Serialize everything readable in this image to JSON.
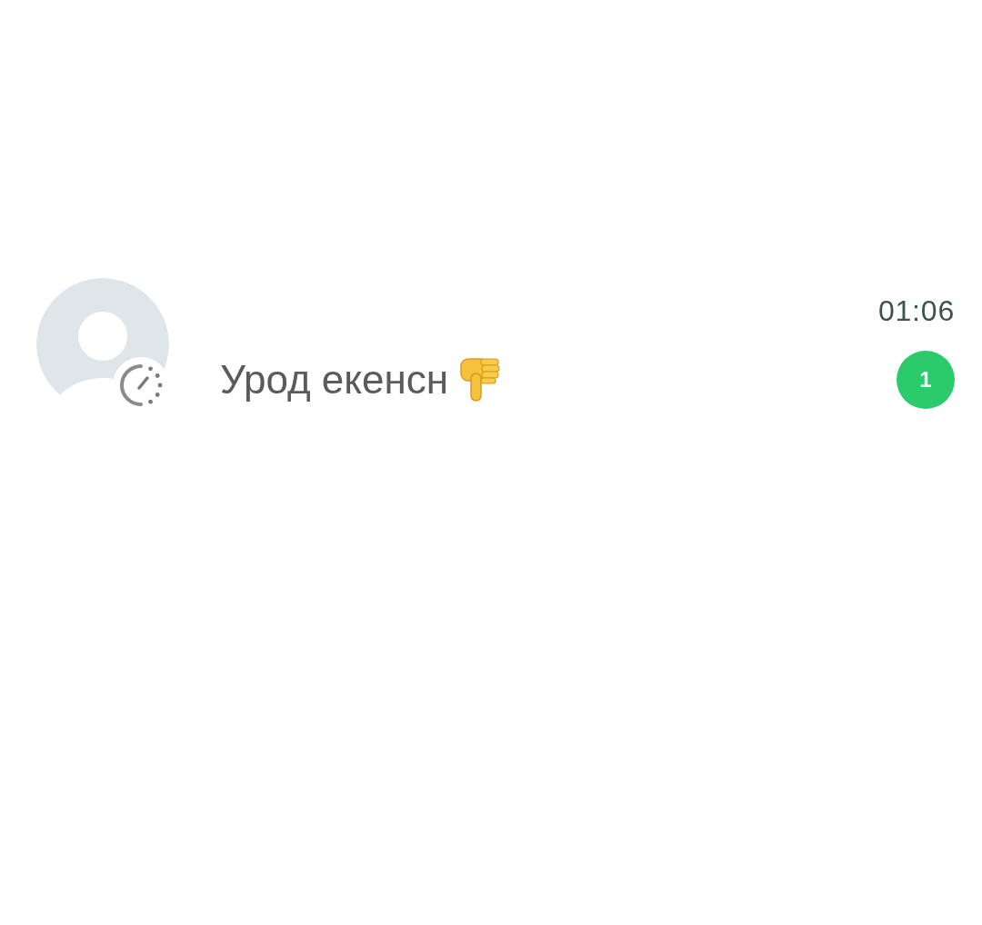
{
  "chat_list": {
    "rows": [
      {
        "text": "Урод екенсн",
        "time": "01:06",
        "unread_count": "1",
        "disappearing_messages": true
      }
    ]
  }
}
